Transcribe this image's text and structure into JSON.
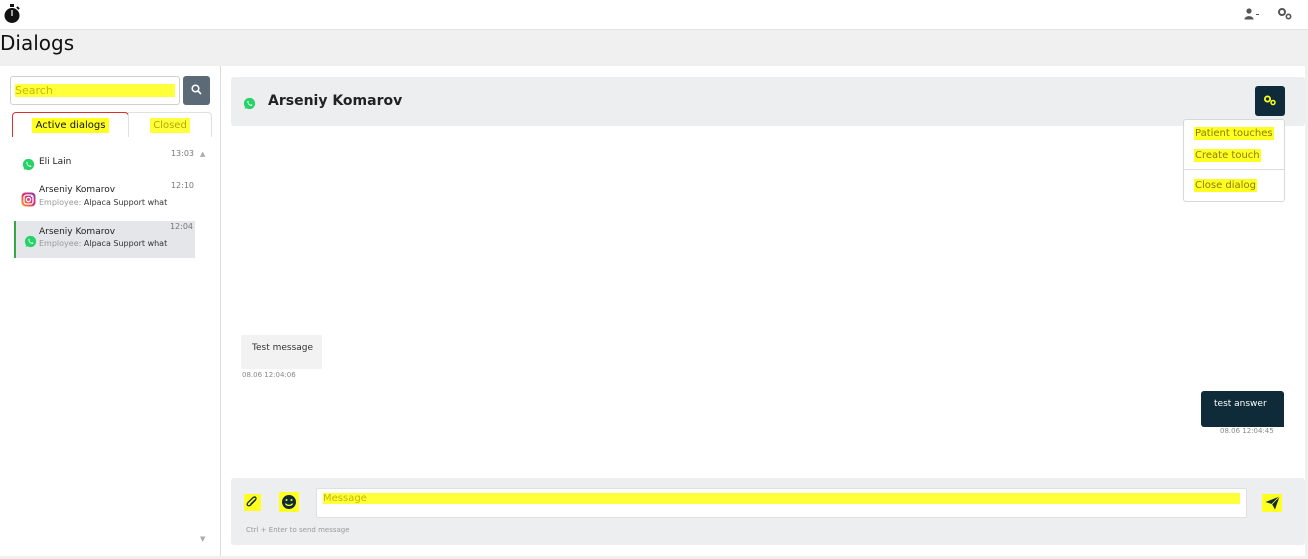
{
  "topbar": {
    "logo_icon": "stopwatch-icon",
    "user_icon": "user-dropdown-icon",
    "settings_icon": "gears-icon"
  },
  "page": {
    "title": "Dialogs"
  },
  "search": {
    "placeholder": "Search",
    "button_icon": "search-icon"
  },
  "tabs": {
    "active_label": "Active dialogs",
    "closed_label": "Closed"
  },
  "dialogs": [
    {
      "name": "Eli Lain",
      "time": "13:03",
      "channel": "whatsapp",
      "employee_label": "",
      "employee_value": ""
    },
    {
      "name": "Arseniy Komarov",
      "time": "12:10",
      "channel": "instagram",
      "employee_label": "Employee:",
      "employee_value": "Alpaca Support what"
    },
    {
      "name": "Arseniy Komarov",
      "time": "12:04",
      "channel": "whatsapp",
      "employee_label": "Employee:",
      "employee_value": "Alpaca Support what",
      "selected": true
    }
  ],
  "chat": {
    "contact_name": "Arseniy Komarov",
    "channel": "whatsapp",
    "menu": {
      "patient_touches": "Patient touches",
      "create_touch": "Create touch",
      "close_dialog": "Close dialog"
    },
    "messages": [
      {
        "direction": "in",
        "text": "Test message",
        "time": "08.06 12:04:06"
      },
      {
        "direction": "out",
        "text": "test answer",
        "time": "08.06 12:04:45"
      }
    ]
  },
  "composer": {
    "placeholder": "Message",
    "hint": "Ctrl + Enter to send message",
    "attach_icon": "paperclip-icon",
    "emoji_icon": "smiley-icon",
    "send_icon": "paper-plane-icon"
  },
  "colors": {
    "accent_dark": "#0f2a38",
    "highlight": "#ffff22",
    "active_tab_border": "#d63030",
    "whatsapp": "#25d366",
    "search_button": "#5b6a76"
  }
}
